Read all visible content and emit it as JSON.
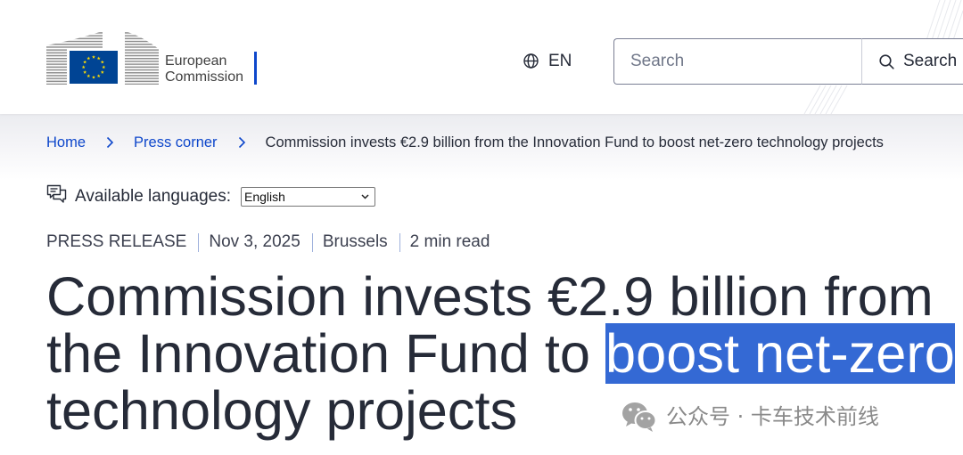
{
  "header": {
    "logo": {
      "icon": "european-commission-logo",
      "line1": "European",
      "line2": "Commission"
    },
    "language_switcher": {
      "icon": "globe-icon",
      "code": "EN"
    },
    "search": {
      "value": "",
      "placeholder": "Search",
      "button_icon": "search-icon",
      "button_label": "Search"
    }
  },
  "breadcrumb": {
    "separator_icon": "chevron-right-icon",
    "items": [
      {
        "label": "Home",
        "current": false
      },
      {
        "label": "Press corner",
        "current": false
      },
      {
        "label": "Commission invests €2.9 billion from the Innovation Fund to boost net-zero technology projects",
        "current": true
      }
    ]
  },
  "available_languages": {
    "icon": "languages-chat-icon",
    "label": "Available languages:",
    "selected": "English",
    "select_icon": "chevron-down-icon"
  },
  "meta": {
    "type": "PRESS RELEASE",
    "date": "Nov 3, 2025",
    "location": "Brussels",
    "read_time": "2 min read"
  },
  "headline": {
    "text_before_selection": "Commission invests €2.9 billion from the Innovation Fund to ",
    "selected_text": "boost net-zero",
    "text_after_selection": " technology projects"
  },
  "watermark": {
    "icon": "wechat-icon",
    "text": "公众号 · 卡车技术前线"
  },
  "colors": {
    "link": "#0e47cb",
    "text": "#262b38",
    "logo_bar": "#0e47cb",
    "flag_blue": "#004494",
    "flag_yellow": "#ffde00",
    "selection_highlight": "#3469d4"
  }
}
